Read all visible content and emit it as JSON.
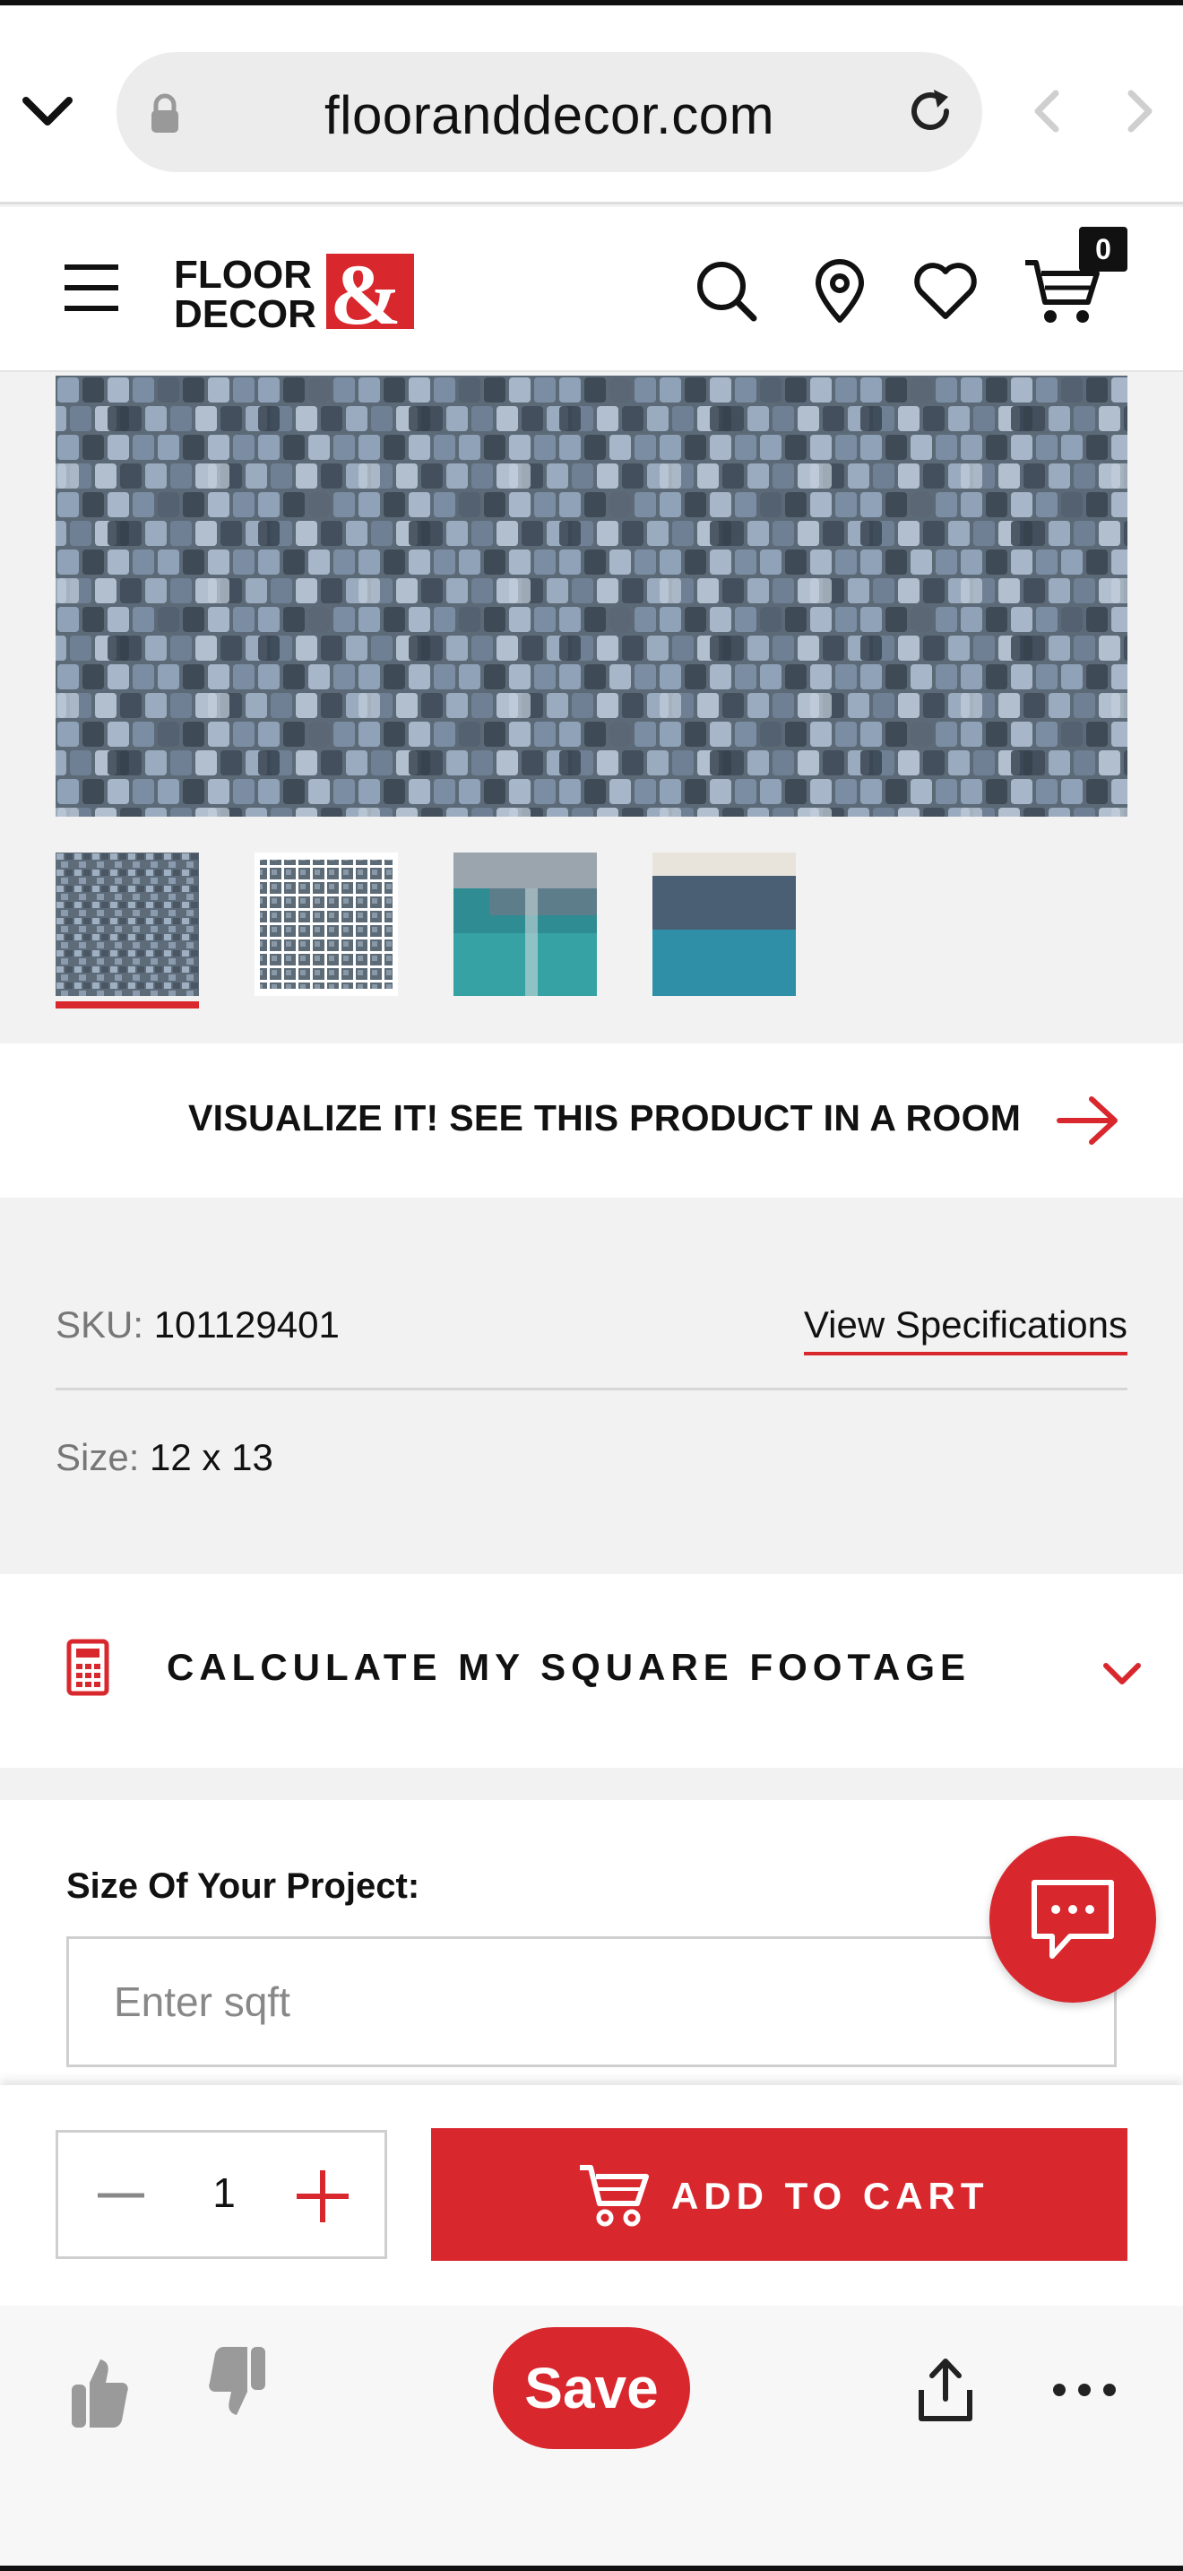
{
  "browser": {
    "url": "flooranddecor.com"
  },
  "header": {
    "logo_line1": "FLOOR",
    "logo_line2": "DECOR",
    "logo_amp": "&",
    "cart_count": "0"
  },
  "gallery": {
    "thumbnail_count": 4,
    "selected_index": 0
  },
  "visualize": {
    "label": "VISUALIZE IT! SEE THIS PRODUCT IN A ROOM"
  },
  "product": {
    "sku_label": "SKU:",
    "sku_value": "101129401",
    "view_specs": "View Specifications",
    "size_label": "Size:",
    "size_value": "12 x 13"
  },
  "calculator": {
    "title": "CALCULATE MY SQUARE FOOTAGE",
    "project_label": "Size Of Your Project:",
    "placeholder": "Enter sqft"
  },
  "cart": {
    "quantity": "1",
    "add_label": "ADD TO CART"
  },
  "bottom": {
    "save_label": "Save"
  },
  "colors": {
    "brand_red": "#d9272e",
    "tile_blue": "#7f93a8"
  }
}
